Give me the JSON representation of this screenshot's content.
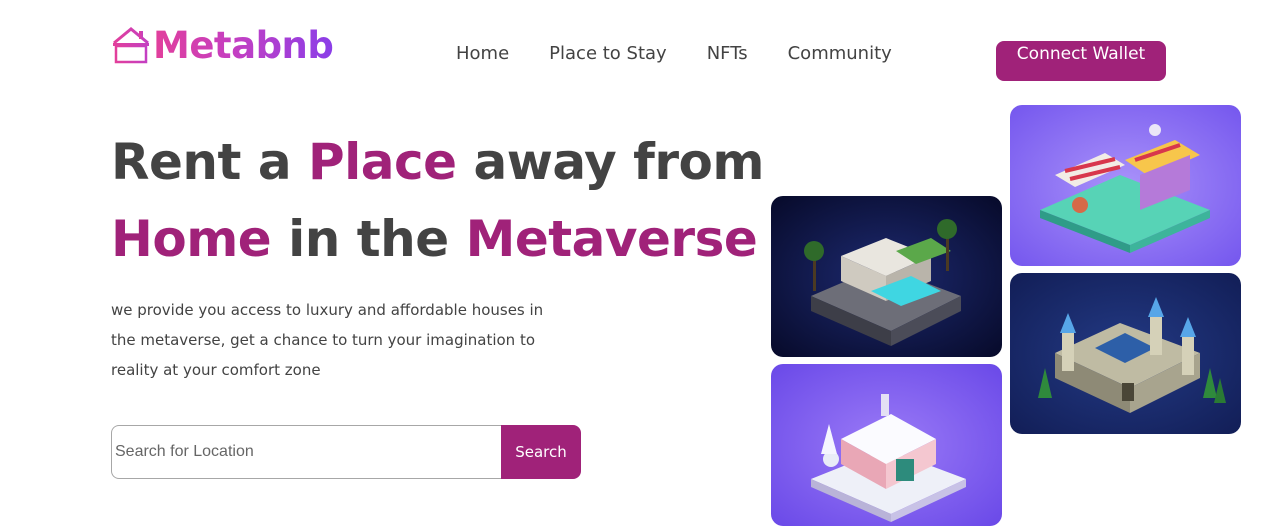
{
  "brand": {
    "name": "Metabnb",
    "icon": "house-icon",
    "gradient": [
      "#e23f9b",
      "#8a3ee8"
    ]
  },
  "nav": {
    "items": [
      {
        "label": "Home"
      },
      {
        "label": "Place to Stay"
      },
      {
        "label": "NFTs"
      },
      {
        "label": "Community"
      }
    ],
    "cta_label": "Connect Wallet"
  },
  "hero": {
    "title_line1": {
      "part1": "Rent a ",
      "part2": "Place",
      "part3": " away from"
    },
    "title_line2": {
      "part1": "Home",
      "part2": " in the ",
      "part3": "Metaverse"
    },
    "description": "we provide you access to luxury and affordable houses in the metaverse, get a chance to turn your imagination to reality at your comfort zone"
  },
  "search": {
    "placeholder": "Search for Location",
    "value": "",
    "button_label": "Search"
  },
  "gallery": [
    {
      "name": "villa-image"
    },
    {
      "name": "snow-cabin-image"
    },
    {
      "name": "market-image"
    },
    {
      "name": "castle-image"
    }
  ],
  "colors": {
    "accent": "#a02279",
    "text": "#434343"
  }
}
